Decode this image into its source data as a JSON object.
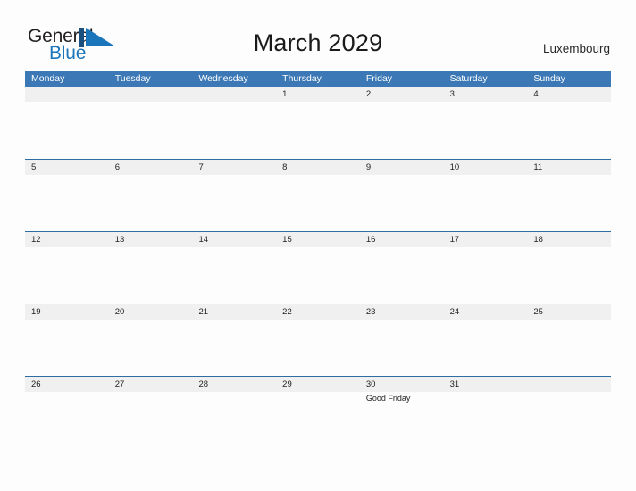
{
  "brand": {
    "name_part1": "General",
    "name_part2": "Blue",
    "mark_icon": "triangle-flag-icon",
    "color_dark": "#231f20",
    "color_blue": "#1b75bb"
  },
  "header": {
    "title": "March 2029",
    "location": "Luxembourg"
  },
  "theme": {
    "header_bar_color": "#3b78b5",
    "date_band_color": "#f0f0f0",
    "row_rule_color": "#2e6ca4",
    "page_background": "#fdfdfe",
    "text_color": "#222222"
  },
  "calendar": {
    "month": "March",
    "year": "2029",
    "weekday_headers": [
      "Monday",
      "Tuesday",
      "Wednesday",
      "Thursday",
      "Friday",
      "Saturday",
      "Sunday"
    ],
    "weeks": [
      {
        "days": [
          {
            "date": "",
            "event": ""
          },
          {
            "date": "",
            "event": ""
          },
          {
            "date": "",
            "event": ""
          },
          {
            "date": "1",
            "event": ""
          },
          {
            "date": "2",
            "event": ""
          },
          {
            "date": "3",
            "event": ""
          },
          {
            "date": "4",
            "event": ""
          }
        ]
      },
      {
        "days": [
          {
            "date": "5",
            "event": ""
          },
          {
            "date": "6",
            "event": ""
          },
          {
            "date": "7",
            "event": ""
          },
          {
            "date": "8",
            "event": ""
          },
          {
            "date": "9",
            "event": ""
          },
          {
            "date": "10",
            "event": ""
          },
          {
            "date": "11",
            "event": ""
          }
        ]
      },
      {
        "days": [
          {
            "date": "12",
            "event": ""
          },
          {
            "date": "13",
            "event": ""
          },
          {
            "date": "14",
            "event": ""
          },
          {
            "date": "15",
            "event": ""
          },
          {
            "date": "16",
            "event": ""
          },
          {
            "date": "17",
            "event": ""
          },
          {
            "date": "18",
            "event": ""
          }
        ]
      },
      {
        "days": [
          {
            "date": "19",
            "event": ""
          },
          {
            "date": "20",
            "event": ""
          },
          {
            "date": "21",
            "event": ""
          },
          {
            "date": "22",
            "event": ""
          },
          {
            "date": "23",
            "event": ""
          },
          {
            "date": "24",
            "event": ""
          },
          {
            "date": "25",
            "event": ""
          }
        ]
      },
      {
        "days": [
          {
            "date": "26",
            "event": ""
          },
          {
            "date": "27",
            "event": ""
          },
          {
            "date": "28",
            "event": ""
          },
          {
            "date": "29",
            "event": ""
          },
          {
            "date": "30",
            "event": "Good Friday"
          },
          {
            "date": "31",
            "event": ""
          },
          {
            "date": "",
            "event": ""
          }
        ]
      }
    ]
  }
}
